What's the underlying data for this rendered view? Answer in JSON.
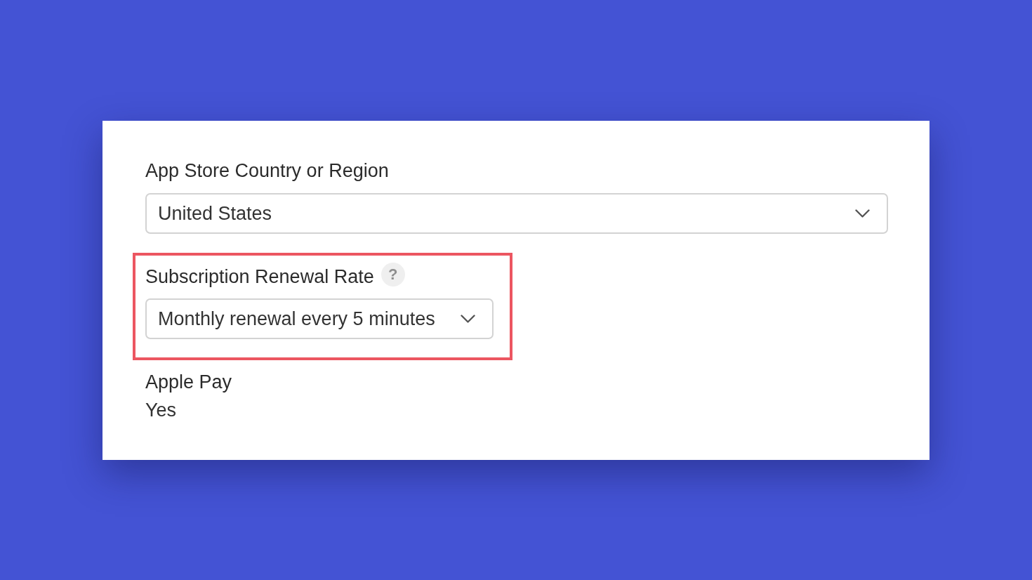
{
  "fields": [
    {
      "kind": "select",
      "label": "App Store Country or Region",
      "value": "United States",
      "highlighted": false
    },
    {
      "kind": "select",
      "label": "Subscription Renewal Rate",
      "help_badge": "?",
      "value": "Monthly renewal every 5 minutes",
      "highlighted": true
    },
    {
      "kind": "text",
      "label": "Apple Pay",
      "value": "Yes",
      "highlighted": false
    }
  ]
}
